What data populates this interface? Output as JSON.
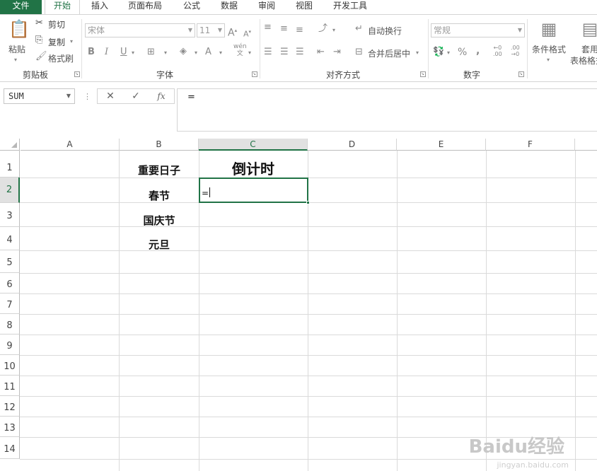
{
  "tabs": [
    "文件",
    "开始",
    "插入",
    "页面布局",
    "公式",
    "数据",
    "审阅",
    "视图",
    "开发工具"
  ],
  "clipboard": {
    "paste": "粘贴",
    "cut": "剪切",
    "copy": "复制",
    "format_painter": "格式刷",
    "label": "剪贴板"
  },
  "font": {
    "name": "宋体",
    "size": "11",
    "bold": "B",
    "italic": "I",
    "underline": "U",
    "label": "字体",
    "pinyin": "wén"
  },
  "alignment": {
    "wrap_text": "自动换行",
    "merge_center": "合并后居中",
    "label": "对齐方式"
  },
  "number": {
    "format": "常规",
    "percent": "%",
    "comma": ",",
    "label": "数字"
  },
  "styles": {
    "conditional_format": "条件格式",
    "format_table_line1": "套用",
    "format_table_line2": "表格格式"
  },
  "formula_bar": {
    "name_box": "SUM",
    "cancel": "✕",
    "enter": "✓",
    "fx": "fx",
    "content": "="
  },
  "columns": [
    "A",
    "B",
    "C",
    "D",
    "E",
    "F"
  ],
  "rows": [
    "1",
    "2",
    "3",
    "4",
    "5",
    "6",
    "7",
    "8",
    "9",
    "10",
    "11",
    "12",
    "13",
    "14"
  ],
  "cells": {
    "b1": "重要日子",
    "c1": "倒计时",
    "b2": "春节",
    "b3": "国庆节",
    "b4": "元旦",
    "c2_editing": "="
  },
  "watermark": {
    "brand": "Baidu经验",
    "url": "jingyan.baidu.com"
  },
  "colors": {
    "accent": "#217346",
    "grid": "#dadada",
    "header_selected": "#e1e1e1"
  }
}
